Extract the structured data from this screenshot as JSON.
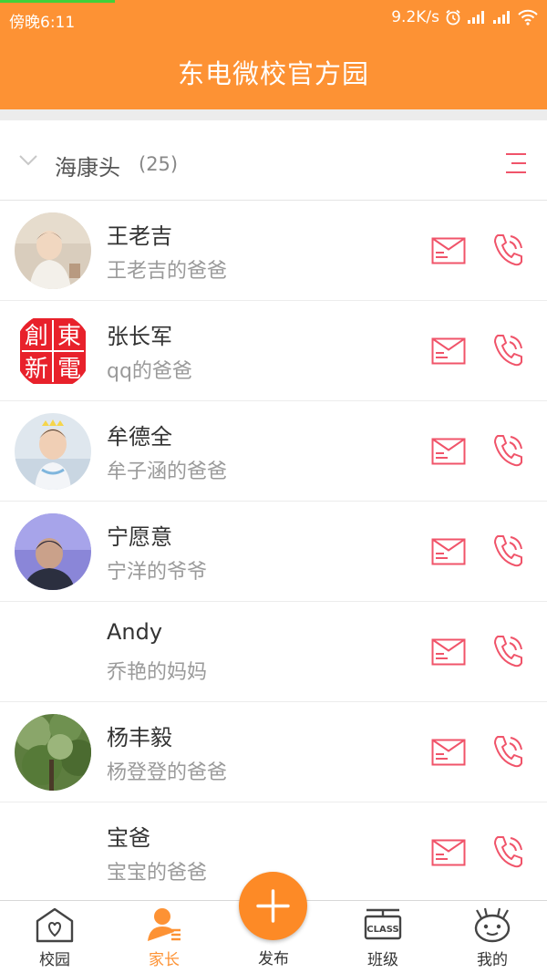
{
  "status_bar": {
    "time": "傍晚6:11",
    "net_speed": "9.2K/s",
    "icons": [
      "alarm-icon",
      "signal-icon",
      "signal-icon",
      "wifi-icon"
    ]
  },
  "header": {
    "title": "东电微校官方园"
  },
  "group": {
    "name": "海康头",
    "count": "(25)",
    "expanded": true,
    "icons": [
      "chevron-down-icon",
      "menu-icon"
    ]
  },
  "contacts": [
    {
      "name": "王老吉",
      "relation": "王老吉的爸爸",
      "avatar": "baby-photo"
    },
    {
      "name": "张长军",
      "relation": "qq的爸爸",
      "avatar": "red-seal-logo",
      "avatar_text": [
        "創",
        "東",
        "新",
        "電"
      ]
    },
    {
      "name": "牟德全",
      "relation": "牟子涵的爸爸",
      "avatar": "child-photo"
    },
    {
      "name": "宁愿意",
      "relation": "宁洋的爷爷",
      "avatar": "boy-photo"
    },
    {
      "name": "Andy",
      "relation": "乔艳的妈妈",
      "avatar": "none"
    },
    {
      "name": "杨丰毅",
      "relation": "杨登登的爸爸",
      "avatar": "tree-photo"
    },
    {
      "name": "宝爸",
      "relation": "宝宝的爸爸",
      "avatar": "none"
    }
  ],
  "tabs": [
    {
      "label": "校园",
      "icon": "school-icon",
      "active": false
    },
    {
      "label": "家长",
      "icon": "parent-icon",
      "active": true
    },
    {
      "label": "发布",
      "icon": "plus-icon",
      "active": false
    },
    {
      "label": "班级",
      "icon": "class-icon",
      "active": false
    },
    {
      "label": "我的",
      "icon": "profile-face-icon",
      "active": false
    }
  ],
  "colors": {
    "brand_orange": "#fd9234",
    "action_red": "#f0546a",
    "active_tab": "#fd9234",
    "text_primary": "#333333",
    "text_secondary": "#9a9a9a"
  }
}
